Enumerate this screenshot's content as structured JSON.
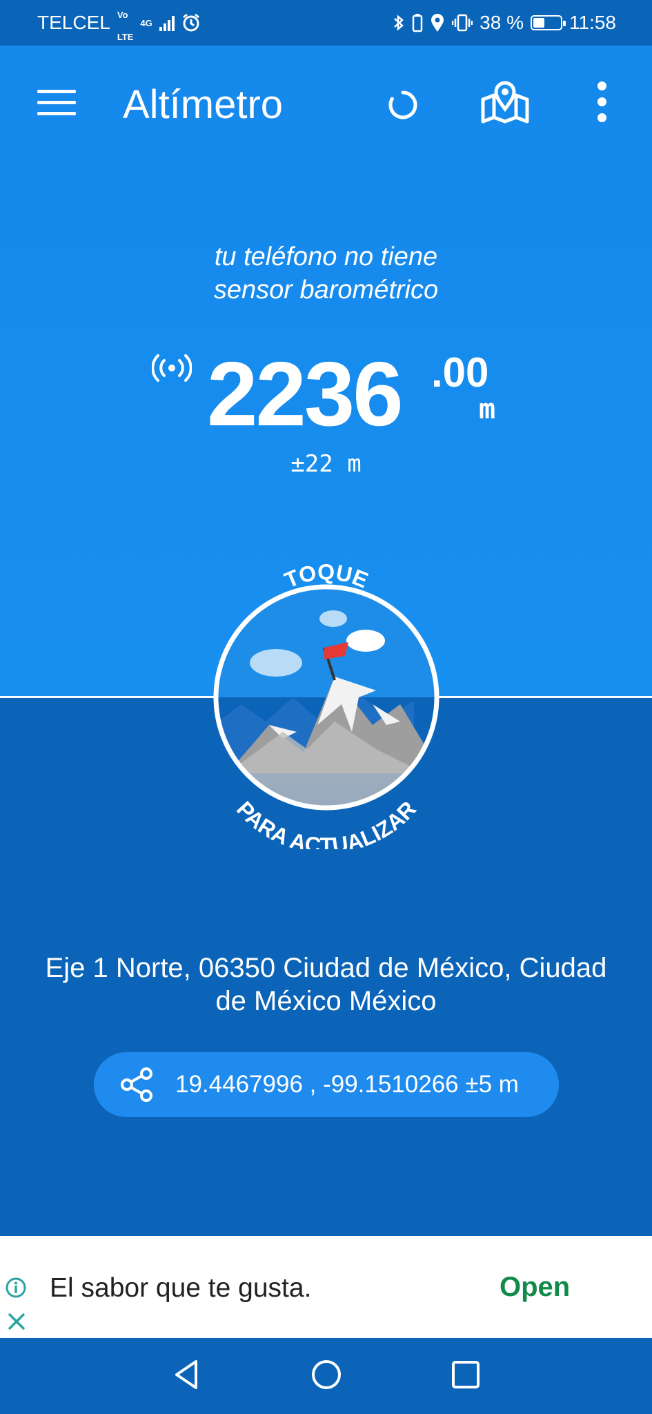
{
  "status_bar": {
    "carrier": "TELCEL",
    "volte_top": "Vo",
    "volte_bottom": "LTE",
    "network": "4G",
    "battery": "38 %",
    "time": "11:58"
  },
  "app_bar": {
    "title": "Altímetro",
    "icons": [
      "menu-icon",
      "refresh-icon",
      "map-icon",
      "more-icon"
    ]
  },
  "main": {
    "no_sensor_line1": "tu teléfono no tiene",
    "no_sensor_line2": "sensor barométrico",
    "altitude_integer": "2236",
    "altitude_decimal": ".00",
    "altitude_unit": "m",
    "accuracy": "±22 m",
    "tap_top": "TOQUE",
    "tap_bottom": "PARA ACTUALIZAR",
    "address": "Eje 1 Norte, 06350 Ciudad de México, Ciudad de México México",
    "coordinates": "19.4467996 , -99.1510266 ±5 m"
  },
  "ad": {
    "text": "El sabor que te gusta.",
    "cta": "Open"
  },
  "colors": {
    "top_blue": "#1890f0",
    "bottom_blue": "#0b64b8",
    "pill_blue": "#1f8bee",
    "flag_red": "#e53935",
    "ad_green": "#128a4a"
  }
}
